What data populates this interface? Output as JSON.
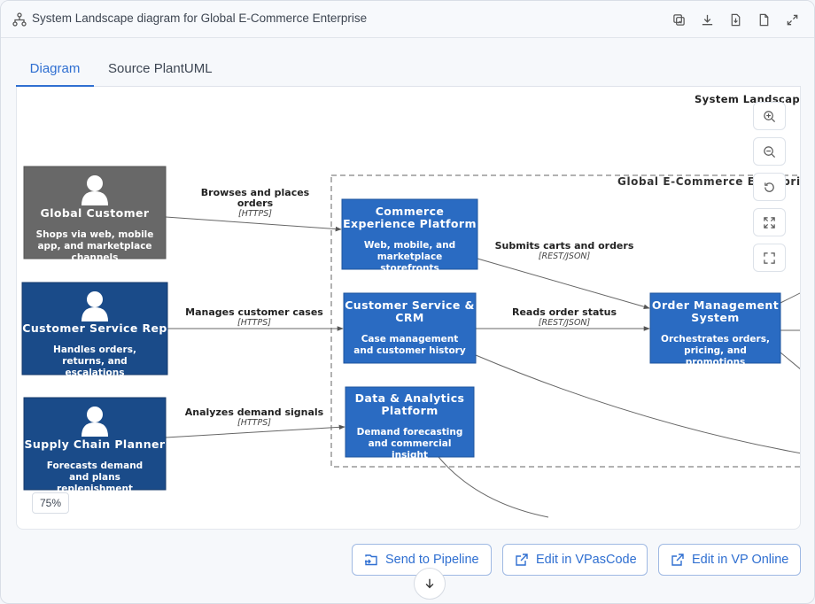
{
  "window": {
    "title": "System Landscape diagram for Global E-Commerce Enterprise",
    "toolbar_icons": [
      "copy-image-icon",
      "download-icon",
      "export-file-icon",
      "document-icon",
      "expand-icon"
    ]
  },
  "tabs": [
    {
      "label": "Diagram",
      "active": true
    },
    {
      "label": "Source PlantUML",
      "active": false
    }
  ],
  "diagram": {
    "title": "System Landscape d",
    "boundary_label": "Global E-Commerce Enterprise",
    "persons": [
      {
        "name": "Global Customer",
        "description": "Shops via web, mobile app, and marketplace channels",
        "color": "#686868"
      },
      {
        "name": "Customer Service Rep",
        "description": "Handles orders, returns, and escalations",
        "color": "#1a4b89"
      },
      {
        "name": "Supply Chain Planner",
        "description": "Forecasts demand and plans replenishment",
        "color": "#1a4b89"
      }
    ],
    "systems": [
      {
        "name_line1": "Commerce",
        "name_line2": "Experience Platform",
        "description": "Web, mobile, and marketplace storefronts",
        "color": "#2a6bc2"
      },
      {
        "name_line1": "Customer Service &",
        "name_line2": "CRM",
        "description": "Case management and customer history",
        "color": "#2a6bc2"
      },
      {
        "name_line1": "Data & Analytics",
        "name_line2": "Platform",
        "description": "Demand forecasting and commercial insight",
        "color": "#2a6bc2"
      },
      {
        "name_line1": "Order Management",
        "name_line2": "System",
        "description": "Orchestrates orders, pricing, and promotions",
        "color": "#2a6bc2"
      }
    ],
    "relations": [
      {
        "label_line1": "Browses and places",
        "label_line2": "orders",
        "tech": "[HTTPS]"
      },
      {
        "label_line1": "Manages customer cases",
        "label_line2": "",
        "tech": "[HTTPS]"
      },
      {
        "label_line1": "Analyzes demand signals",
        "label_line2": "",
        "tech": "[HTTPS]"
      },
      {
        "label_line1": "Submits carts and orders",
        "label_line2": "",
        "tech": "[REST/JSON]"
      },
      {
        "label_line1": "Reads order status",
        "label_line2": "",
        "tech": "[REST/JSON]"
      }
    ]
  },
  "zoom": {
    "level": "75%",
    "controls": [
      "zoom-in-icon",
      "zoom-out-icon",
      "reset-icon",
      "fit-icon",
      "fullscreen-icon"
    ]
  },
  "footer": {
    "send_pipeline": "Send to Pipeline",
    "edit_vpascode": "Edit in VPasCode",
    "edit_vponline": "Edit in VP Online"
  }
}
